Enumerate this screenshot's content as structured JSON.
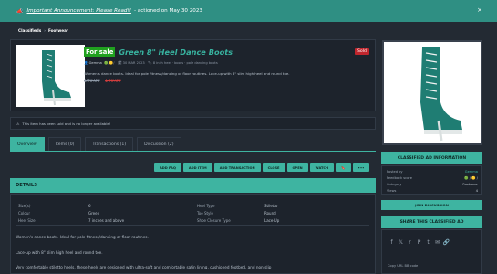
{
  "announcement": {
    "link_text": "Important Announcement: Please Read!!",
    "suffix": "- actioned on May 30 2023",
    "close": "×"
  },
  "breadcrumb": [
    "Classifieds",
    "Footwear"
  ],
  "listing": {
    "status_label": "For sale",
    "title": "Green 8\" Heel Dance Boots",
    "sold_badge": "Sold",
    "author": "Gemma",
    "date": "30 MAR 2023",
    "meta_tags": "8 inch heel · boots · pole dancing boots",
    "short_description": "Women's dance boots. Ideal for pole fitness/dancing or floor routines. Lace-up with 8\" slim high heel and round toe.",
    "old_price": "£90.00",
    "new_price": "£40.00"
  },
  "warning": "This item has been sold and is no longer available!",
  "tabs": [
    "Overview",
    "Items (0)",
    "Transactions (1)",
    "Discussion (2)"
  ],
  "actions": [
    "ADD FAQ",
    "ADD ITEM",
    "ADD TRANSACTION",
    "CLOSE",
    "OPEN",
    "WATCH",
    "🔖",
    "•••"
  ],
  "details": {
    "header": "DETAILS",
    "specs": [
      {
        "label": "Size(s)",
        "value": "6"
      },
      {
        "label": "Colour",
        "value": "Green"
      },
      {
        "label": "Heel Size",
        "value": "7 inches and above"
      },
      {
        "label": "Heel Type",
        "value": "Stiletto"
      },
      {
        "label": "Toe Style",
        "value": "Round"
      },
      {
        "label": "Shoe Closure Type",
        "value": "Lace-Up"
      }
    ],
    "paragraphs": [
      "Women's dance boots. Ideal for pole fitness/dancing or floor routines.",
      "Lace-up with 8\" slim high heel and round toe.",
      "Very comfortable stiletto heels, these heels are designed with ultra-soft and comfortable satin lining, cushioned footbed, and non-slip"
    ]
  },
  "classified_info": {
    "header": "CLASSIFIED AD INFORMATION",
    "rows": [
      {
        "label": "Posted by",
        "value": "Gemma"
      },
      {
        "label": "Feedback score",
        "value": "🟢 / 🟡 /"
      },
      {
        "label": "Category",
        "value": "Footwear"
      },
      {
        "label": "Views",
        "value": "4"
      }
    ]
  },
  "join_button": "JOIN DISCUSSION",
  "share": {
    "header": "SHARE THIS CLASSIFIED AD",
    "icons": [
      "f",
      "𝕏",
      "r",
      "P",
      "t",
      "✉",
      "🔗"
    ],
    "copy_text": "Copy URL BB code"
  },
  "colors": {
    "accent": "#3eb4a1",
    "announcement": "#2f8f83",
    "for_sale": "#20a01f",
    "sold": "#c0262d",
    "price_red": "#d13d3d"
  }
}
